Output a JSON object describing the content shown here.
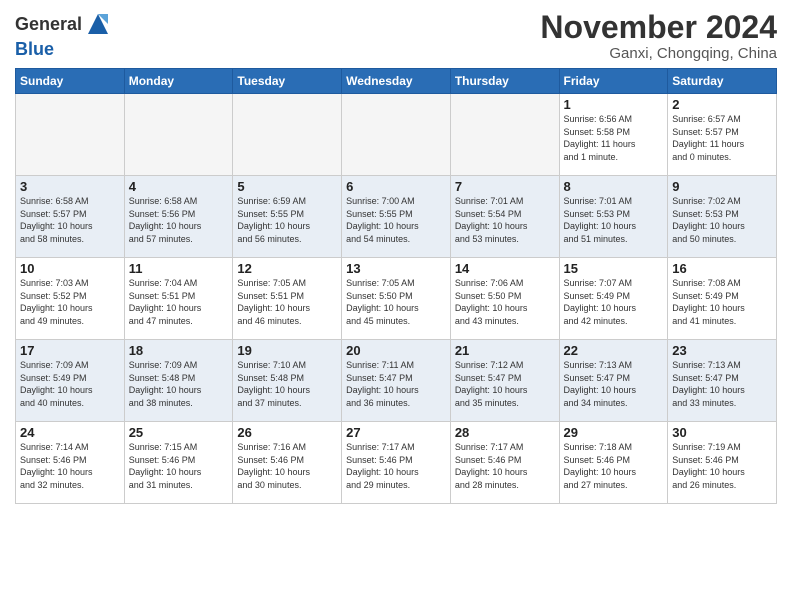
{
  "header": {
    "logo_line1": "General",
    "logo_line2": "Blue",
    "month_title": "November 2024",
    "location": "Ganxi, Chongqing, China"
  },
  "weekdays": [
    "Sunday",
    "Monday",
    "Tuesday",
    "Wednesday",
    "Thursday",
    "Friday",
    "Saturday"
  ],
  "weeks": [
    [
      {
        "day": "",
        "info": ""
      },
      {
        "day": "",
        "info": ""
      },
      {
        "day": "",
        "info": ""
      },
      {
        "day": "",
        "info": ""
      },
      {
        "day": "",
        "info": ""
      },
      {
        "day": "1",
        "info": "Sunrise: 6:56 AM\nSunset: 5:58 PM\nDaylight: 11 hours\nand 1 minute."
      },
      {
        "day": "2",
        "info": "Sunrise: 6:57 AM\nSunset: 5:57 PM\nDaylight: 11 hours\nand 0 minutes."
      }
    ],
    [
      {
        "day": "3",
        "info": "Sunrise: 6:58 AM\nSunset: 5:57 PM\nDaylight: 10 hours\nand 58 minutes."
      },
      {
        "day": "4",
        "info": "Sunrise: 6:58 AM\nSunset: 5:56 PM\nDaylight: 10 hours\nand 57 minutes."
      },
      {
        "day": "5",
        "info": "Sunrise: 6:59 AM\nSunset: 5:55 PM\nDaylight: 10 hours\nand 56 minutes."
      },
      {
        "day": "6",
        "info": "Sunrise: 7:00 AM\nSunset: 5:55 PM\nDaylight: 10 hours\nand 54 minutes."
      },
      {
        "day": "7",
        "info": "Sunrise: 7:01 AM\nSunset: 5:54 PM\nDaylight: 10 hours\nand 53 minutes."
      },
      {
        "day": "8",
        "info": "Sunrise: 7:01 AM\nSunset: 5:53 PM\nDaylight: 10 hours\nand 51 minutes."
      },
      {
        "day": "9",
        "info": "Sunrise: 7:02 AM\nSunset: 5:53 PM\nDaylight: 10 hours\nand 50 minutes."
      }
    ],
    [
      {
        "day": "10",
        "info": "Sunrise: 7:03 AM\nSunset: 5:52 PM\nDaylight: 10 hours\nand 49 minutes."
      },
      {
        "day": "11",
        "info": "Sunrise: 7:04 AM\nSunset: 5:51 PM\nDaylight: 10 hours\nand 47 minutes."
      },
      {
        "day": "12",
        "info": "Sunrise: 7:05 AM\nSunset: 5:51 PM\nDaylight: 10 hours\nand 46 minutes."
      },
      {
        "day": "13",
        "info": "Sunrise: 7:05 AM\nSunset: 5:50 PM\nDaylight: 10 hours\nand 45 minutes."
      },
      {
        "day": "14",
        "info": "Sunrise: 7:06 AM\nSunset: 5:50 PM\nDaylight: 10 hours\nand 43 minutes."
      },
      {
        "day": "15",
        "info": "Sunrise: 7:07 AM\nSunset: 5:49 PM\nDaylight: 10 hours\nand 42 minutes."
      },
      {
        "day": "16",
        "info": "Sunrise: 7:08 AM\nSunset: 5:49 PM\nDaylight: 10 hours\nand 41 minutes."
      }
    ],
    [
      {
        "day": "17",
        "info": "Sunrise: 7:09 AM\nSunset: 5:49 PM\nDaylight: 10 hours\nand 40 minutes."
      },
      {
        "day": "18",
        "info": "Sunrise: 7:09 AM\nSunset: 5:48 PM\nDaylight: 10 hours\nand 38 minutes."
      },
      {
        "day": "19",
        "info": "Sunrise: 7:10 AM\nSunset: 5:48 PM\nDaylight: 10 hours\nand 37 minutes."
      },
      {
        "day": "20",
        "info": "Sunrise: 7:11 AM\nSunset: 5:47 PM\nDaylight: 10 hours\nand 36 minutes."
      },
      {
        "day": "21",
        "info": "Sunrise: 7:12 AM\nSunset: 5:47 PM\nDaylight: 10 hours\nand 35 minutes."
      },
      {
        "day": "22",
        "info": "Sunrise: 7:13 AM\nSunset: 5:47 PM\nDaylight: 10 hours\nand 34 minutes."
      },
      {
        "day": "23",
        "info": "Sunrise: 7:13 AM\nSunset: 5:47 PM\nDaylight: 10 hours\nand 33 minutes."
      }
    ],
    [
      {
        "day": "24",
        "info": "Sunrise: 7:14 AM\nSunset: 5:46 PM\nDaylight: 10 hours\nand 32 minutes."
      },
      {
        "day": "25",
        "info": "Sunrise: 7:15 AM\nSunset: 5:46 PM\nDaylight: 10 hours\nand 31 minutes."
      },
      {
        "day": "26",
        "info": "Sunrise: 7:16 AM\nSunset: 5:46 PM\nDaylight: 10 hours\nand 30 minutes."
      },
      {
        "day": "27",
        "info": "Sunrise: 7:17 AM\nSunset: 5:46 PM\nDaylight: 10 hours\nand 29 minutes."
      },
      {
        "day": "28",
        "info": "Sunrise: 7:17 AM\nSunset: 5:46 PM\nDaylight: 10 hours\nand 28 minutes."
      },
      {
        "day": "29",
        "info": "Sunrise: 7:18 AM\nSunset: 5:46 PM\nDaylight: 10 hours\nand 27 minutes."
      },
      {
        "day": "30",
        "info": "Sunrise: 7:19 AM\nSunset: 5:46 PM\nDaylight: 10 hours\nand 26 minutes."
      }
    ]
  ]
}
